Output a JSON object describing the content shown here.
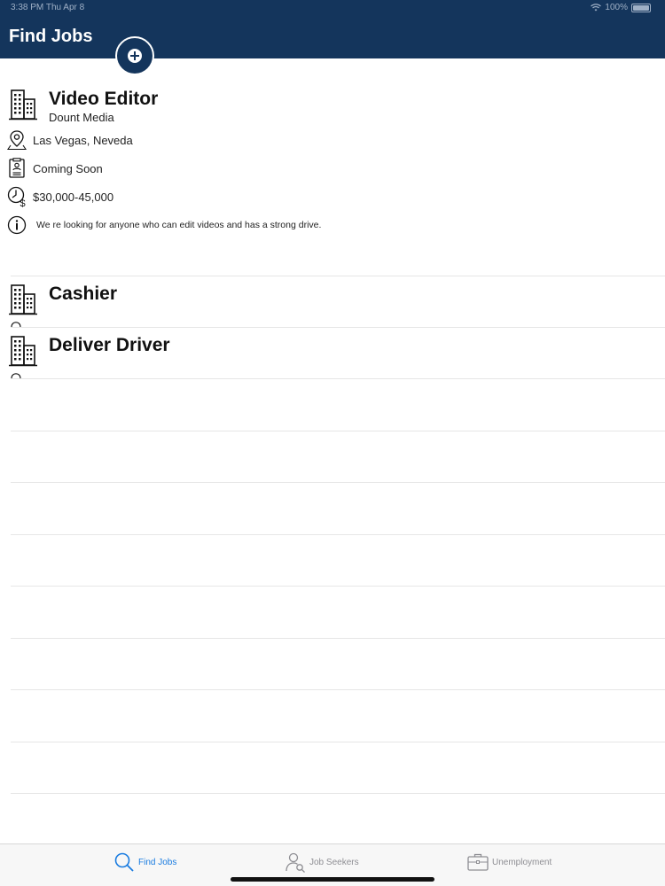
{
  "status_bar": {
    "time": "3:38 PM   Thu Apr 8",
    "battery": "100%"
  },
  "header": {
    "title": "Find Jobs"
  },
  "icons": {
    "add": "plus-circle-icon",
    "building": "building-icon",
    "location": "location-pin-icon",
    "status": "clipboard-badge-icon",
    "salary": "clock-dollar-icon",
    "info": "info-circle-icon"
  },
  "jobs": [
    {
      "title": "Video Editor",
      "company": "Dount Media",
      "location": "Las Vegas, Neveda",
      "status": "Coming Soon",
      "salary": "$30,000-45,000",
      "description": "We re looking for anyone who can edit videos and has a strong drive."
    },
    {
      "title": "Cashier"
    },
    {
      "title": "Deliver Driver"
    }
  ],
  "tabs": [
    {
      "label": "Find Jobs",
      "icon": "search-icon",
      "active": true
    },
    {
      "label": "Job Seekers",
      "icon": "person-search-icon",
      "active": false
    },
    {
      "label": "Unemployment",
      "icon": "briefcase-icon",
      "active": false
    }
  ],
  "colors": {
    "header": "#14355c",
    "accent": "#1a7ce0",
    "tab_inactive": "#8e8e93"
  }
}
